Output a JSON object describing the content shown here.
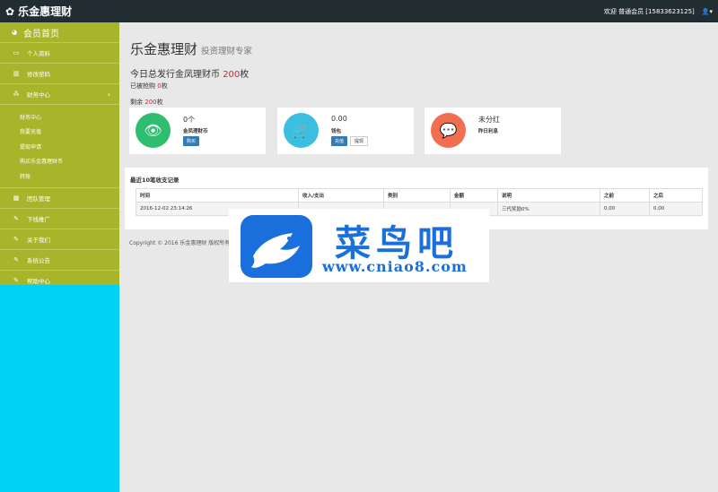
{
  "topbar": {
    "brand": "乐金惠理财",
    "welcome": "欢迎 普通会员 [15833623125]"
  },
  "sidebar": {
    "home": "会员首页",
    "items": [
      {
        "label": "个人资料",
        "icon": "monitor-icon"
      },
      {
        "label": "修改密码",
        "icon": "bar-chart-icon"
      },
      {
        "label": "财务中心",
        "icon": "sitemap-icon"
      }
    ],
    "sub_items": [
      "财务中心",
      "我要充值",
      "提现申请",
      "购买乐金惠理财币",
      "转账"
    ],
    "items2": [
      {
        "label": "团队管理",
        "icon": "table-icon"
      },
      {
        "label": "下线推广",
        "icon": "edit-icon"
      },
      {
        "label": "关于我们",
        "icon": "edit-icon"
      },
      {
        "label": "系统公告",
        "icon": "edit-icon"
      },
      {
        "label": "帮助中心",
        "icon": "edit-icon"
      }
    ]
  },
  "page": {
    "title": "乐金惠理财",
    "subtitle": "投资理财专家",
    "issued_prefix": "今日总发行金凤理财币",
    "issued_value": "200",
    "issued_suffix": "枚",
    "sold_prefix": "已被抢购",
    "sold_value": "0",
    "sold_suffix": "枚",
    "remain_prefix": "剩余",
    "remain_value": "200",
    "remain_suffix": "枚"
  },
  "cards": [
    {
      "value": "0个",
      "label": "金凤理财币",
      "buttons": [
        "购买"
      ],
      "color": "#2fbd70",
      "icon": "eye-icon"
    },
    {
      "value": "0.00",
      "label": "钱包",
      "buttons": [
        "充值",
        "提现"
      ],
      "color": "#3bbfe0",
      "icon": "cart-icon"
    },
    {
      "value": "未分红",
      "label": "昨日利息",
      "buttons": [],
      "color": "#f26e50",
      "icon": "comments-icon"
    }
  ],
  "records": {
    "title": "最近10笔收支记录",
    "headers": [
      "时间",
      "收入/支出",
      "类别",
      "金额",
      "说明",
      "之前",
      "之后"
    ],
    "rows": [
      [
        "2016-12-02 23:14:26",
        "",
        "",
        "",
        "三代奖励0%",
        "0.00",
        "0.00"
      ]
    ]
  },
  "footer": {
    "copyright": "Copyright © 2016 乐金惠理财 版权所有 备"
  },
  "watermark": {
    "title": "菜鸟吧",
    "url": "www.cniao8.com"
  }
}
